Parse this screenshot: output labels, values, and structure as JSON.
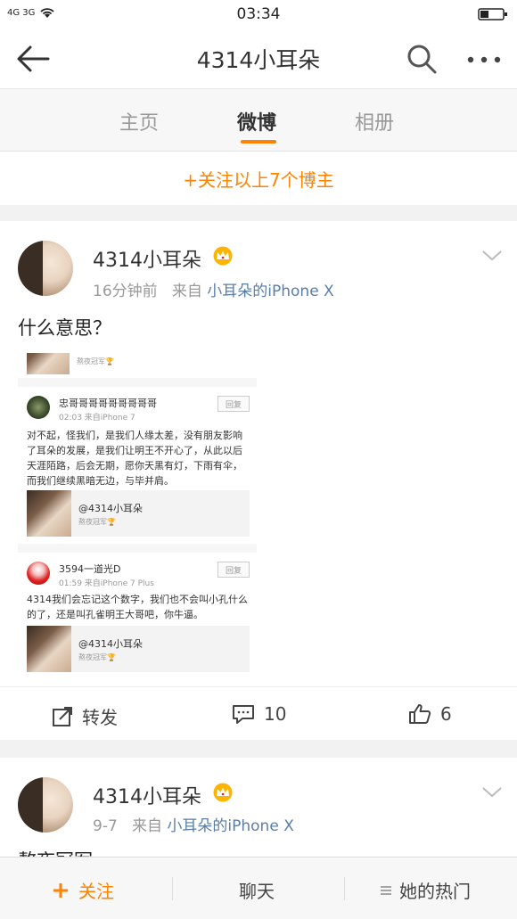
{
  "status_bar": {
    "network": "4G 3G",
    "time": "03:34"
  },
  "header": {
    "title": "4314小耳朵"
  },
  "tabs": [
    {
      "label": "主页",
      "active": false
    },
    {
      "label": "微博",
      "active": true
    },
    {
      "label": "相册",
      "active": false
    }
  ],
  "follow_all_label": "+关注以上7个博主",
  "posts": [
    {
      "username": "4314小耳朵",
      "time": "16分钟前",
      "from": "来自",
      "source": "小耳朵的iPhone X",
      "text": "什么意思？",
      "embedded": {
        "top_caption": "熬夜冠军🏆",
        "comments": [
          {
            "name": "忠哥哥哥哥哥哥哥哥哥",
            "time": "02:03  来自iPhone 7",
            "reply": "回复",
            "text": "对不起，怪我们，是我们人缘太差，没有朋友影响了耳朵的发展，是我们让明王不开心了，从此以后天涯陌路，后会无期，愿你天黑有灯，下雨有伞，而我们继续黑暗无边，与毕并肩。",
            "quote_name": "@4314小耳朵",
            "quote_sub": "熬夜冠军🏆"
          },
          {
            "name": "3594一道光D",
            "time": "01:59  来自iPhone 7 Plus",
            "reply": "回复",
            "text": "4314我们会忘记这个数字，我们也不会叫小孔什么的了，还是叫孔雀明王大哥吧，你牛逼。",
            "quote_name": "@4314小耳朵",
            "quote_sub": "熬夜冠军🏆"
          }
        ]
      },
      "repost_label": "转发",
      "comment_count": "10",
      "like_count": "6"
    },
    {
      "username": "4314小耳朵",
      "time": "9-7",
      "from": "来自",
      "source": "小耳朵的iPhone X",
      "text": "熬夜冠军"
    }
  ],
  "bottom_bar": {
    "follow": "关注",
    "chat": "聊天",
    "hot": "她的热门"
  },
  "colors": {
    "accent": "#ff8200",
    "link": "#5a7ea8"
  }
}
